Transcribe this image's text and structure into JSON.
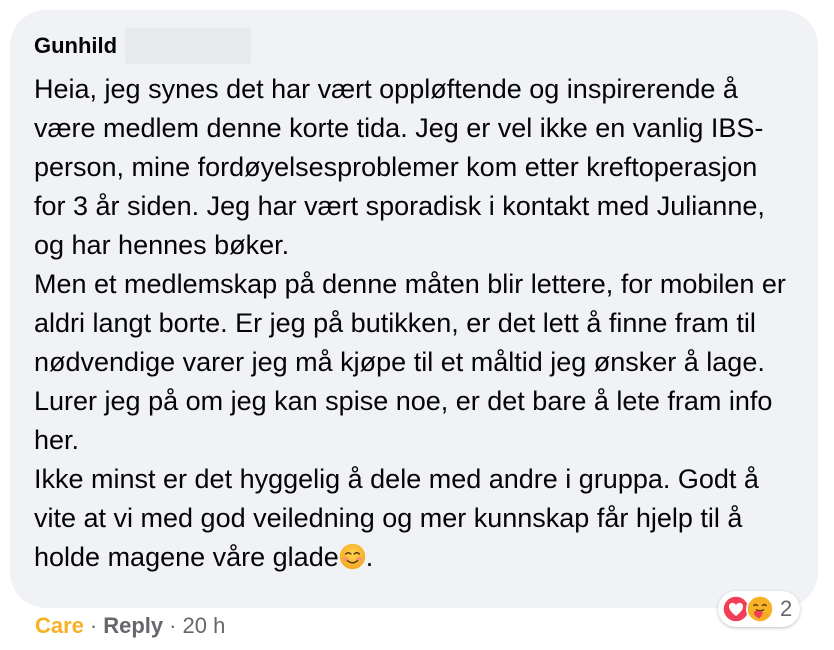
{
  "comment": {
    "author": "Gunhild",
    "paragraphs": [
      "Heia, jeg synes det har vært oppløftende og inspirerende å være medlem denne korte tida. Jeg er vel ikke en vanlig IBS-person, mine fordøyelsesproblemer kom etter kreftoperasjon for 3 år siden. Jeg har vært sporadisk i kontakt med Julianne, og har hennes bøker.",
      "Men et medlemskap på denne måten blir lettere, for mobilen er aldri langt borte. Er jeg på butikken, er det lett å finne fram til nødvendige varer jeg må kjøpe til et måltid jeg ønsker å lage. Lurer jeg på om jeg kan spise noe, er det bare å lete fram info her.",
      "Ikke minst er det hyggelig å dele med andre i gruppa. Godt å vite at vi med god veiledning og mer kunnskap får hjelp til å holde magene våre glade"
    ],
    "trailing_text": ".",
    "trailing_emoji": "smiling-face-icon"
  },
  "reactions": {
    "icons": [
      "love-heart-icon",
      "care-hug-icon"
    ],
    "count": "2"
  },
  "actions": {
    "care_label": "Care",
    "separator": "·",
    "reply_label": "Reply",
    "time": "20 h"
  },
  "colors": {
    "bubble_bg": "#f0f2f5",
    "care_accent": "#f7b125",
    "muted_text": "#65676b",
    "love_red": "#f33e58"
  }
}
